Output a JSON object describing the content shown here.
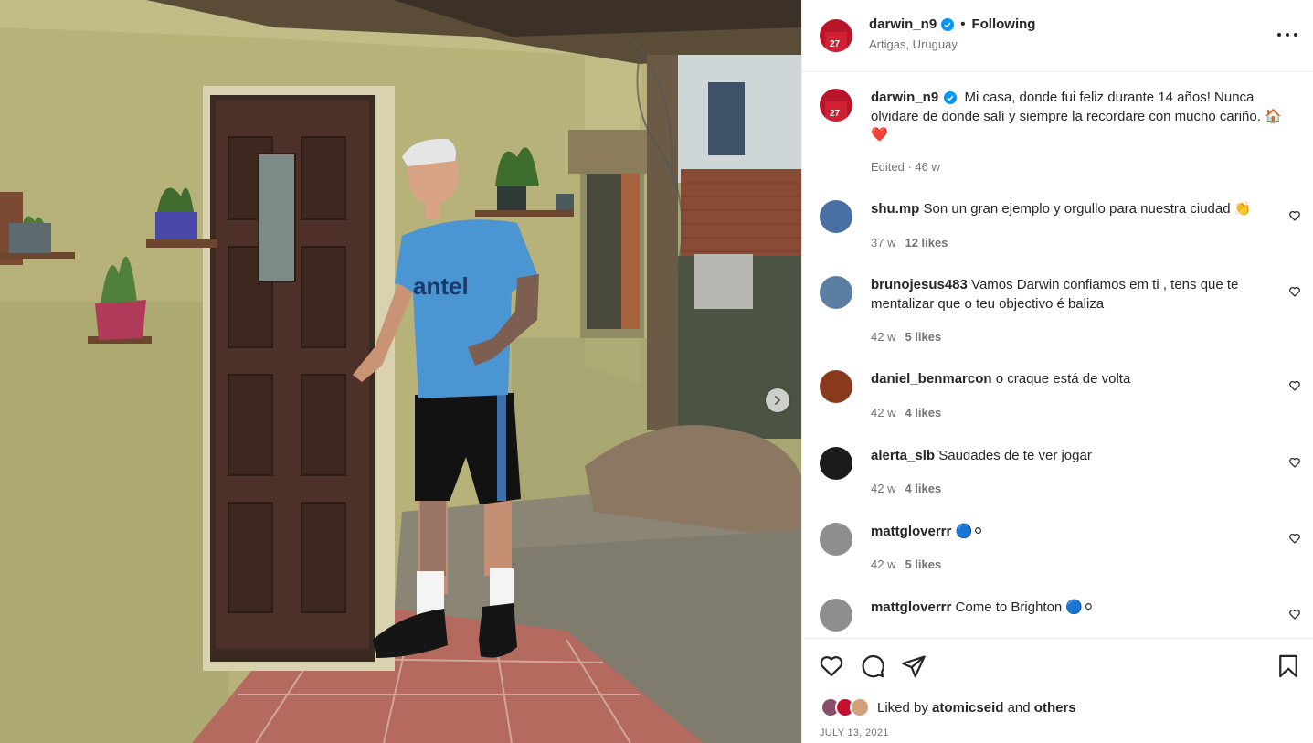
{
  "post": {
    "author": "darwin_n9",
    "follow_status": "Following",
    "location": "Artigas, Uruguay",
    "caption": "Mi casa, donde fui feliz durante 14 años! Nunca olvidare de donde salí y siempre la recordare con mucho cariño. 🏠❤️",
    "caption_meta": "Edited · 46 w",
    "liked_by_prefix": "Liked by",
    "liked_by_user": "atomicseid",
    "liked_by_and": "and",
    "liked_by_others": "others",
    "date": "JULY 13, 2021"
  },
  "comments": [
    {
      "user": "shu.mp",
      "text": "Son un gran ejemplo y orgullo para nuestra ciudad 👏",
      "age": "37 w",
      "likes": "12 likes",
      "avatar_color": "#4a6fa5"
    },
    {
      "user": "brunojesus483",
      "text": "Vamos Darwin confiamos em ti , tens que te mentalizar que o teu objectivo é baliza",
      "age": "42 w",
      "likes": "5 likes",
      "avatar_color": "#5b7fa3"
    },
    {
      "user": "daniel_benmarcon",
      "text": "o craque está de volta",
      "age": "42 w",
      "likes": "4 likes",
      "avatar_color": "#8a3a1c"
    },
    {
      "user": "alerta_slb",
      "text": "Saudades de te ver jogar",
      "age": "42 w",
      "likes": "4 likes",
      "avatar_color": "#1b1b1b"
    },
    {
      "user": "mattgloverrr",
      "text": "🔵⚪",
      "age": "42 w",
      "likes": "5 likes",
      "avatar_color": "#8e8e8e"
    },
    {
      "user": "mattgloverrr",
      "text": "Come to Brighton 🔵⚪",
      "age": "",
      "likes": "",
      "avatar_color": "#8e8e8e"
    }
  ],
  "icons": {
    "verified": "verified-badge-icon",
    "like": "heart-icon",
    "comment": "comment-icon",
    "share": "send-icon",
    "save": "bookmark-icon",
    "next": "chevron-right-icon",
    "more": "more-options-icon"
  },
  "colors": {
    "verified": "#0095f6",
    "text": "#262626",
    "muted": "#737373",
    "border": "#efefef",
    "avatar_red": "#c8102e"
  }
}
